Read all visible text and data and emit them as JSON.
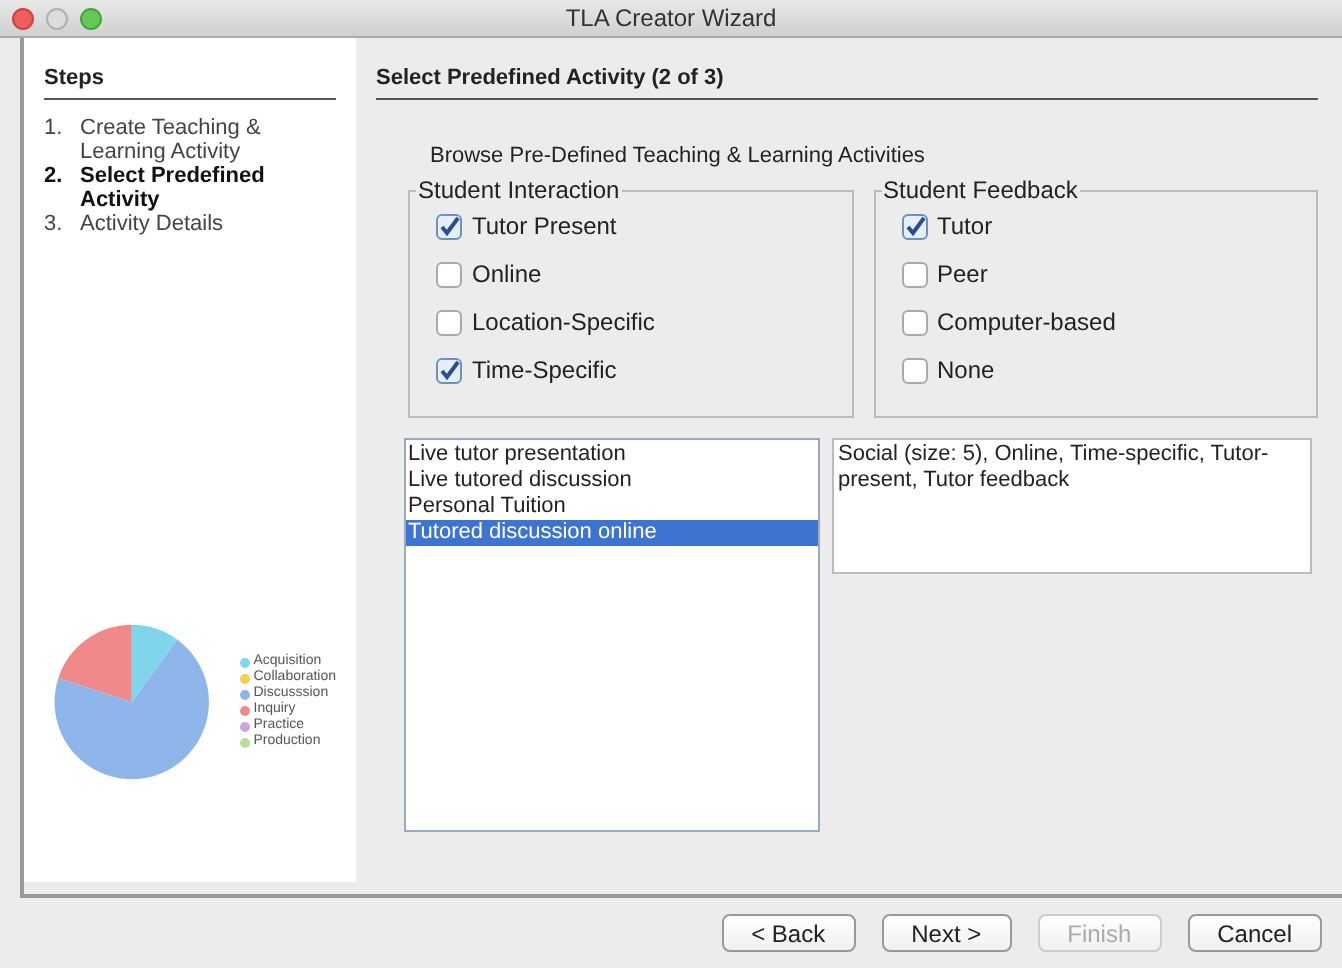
{
  "window": {
    "title": "TLA Creator Wizard"
  },
  "steps": {
    "title": "Steps",
    "items": [
      {
        "number": "1.",
        "label": "Create Teaching & Learning Activity",
        "selected": false
      },
      {
        "number": "2.",
        "label": "Select Predefined Activity",
        "selected": true
      },
      {
        "number": "3.",
        "label": "Activity Details",
        "selected": false
      }
    ]
  },
  "legend": [
    {
      "label": "Acquisition",
      "color": "#7fd6ea"
    },
    {
      "label": "Collaboration",
      "color": "#f2d14a"
    },
    {
      "label": "Discusssion",
      "color": "#8fb6ea"
    },
    {
      "label": "Inquiry",
      "color": "#f08a8a"
    },
    {
      "label": "Practice",
      "color": "#c9a6e0"
    },
    {
      "label": "Production",
      "color": "#b9dc96"
    }
  ],
  "page": {
    "title": "Select Predefined Activity (2 of 3)",
    "subtitle": "Browse Pre-Defined Teaching & Learning Activities"
  },
  "groups": [
    {
      "title": "Student Interaction",
      "options": [
        {
          "label": "Tutor Present",
          "checked": true
        },
        {
          "label": "Online",
          "checked": false
        },
        {
          "label": "Location-Specific",
          "checked": false
        },
        {
          "label": "Time-Specific",
          "checked": true
        }
      ]
    },
    {
      "title": "Student Feedback",
      "options": [
        {
          "label": "Tutor",
          "checked": true
        },
        {
          "label": "Peer",
          "checked": false
        },
        {
          "label": "Computer-based",
          "checked": false
        },
        {
          "label": "None",
          "checked": false
        }
      ]
    }
  ],
  "activities": [
    {
      "label": "Live tutor presentation",
      "selected": false
    },
    {
      "label": "Live tutored discussion",
      "selected": false
    },
    {
      "label": "Personal Tuition",
      "selected": false
    },
    {
      "label": "Tutored discussion online",
      "selected": true
    }
  ],
  "description": "Social (size: 5), Online, Time-specific, Tutor-present, Tutor feedback",
  "buttons": [
    {
      "label": "< Back",
      "disabled": false
    },
    {
      "label": "Next >",
      "disabled": false
    },
    {
      "label": "Finish",
      "disabled": true
    },
    {
      "label": "Cancel",
      "disabled": false
    }
  ]
}
